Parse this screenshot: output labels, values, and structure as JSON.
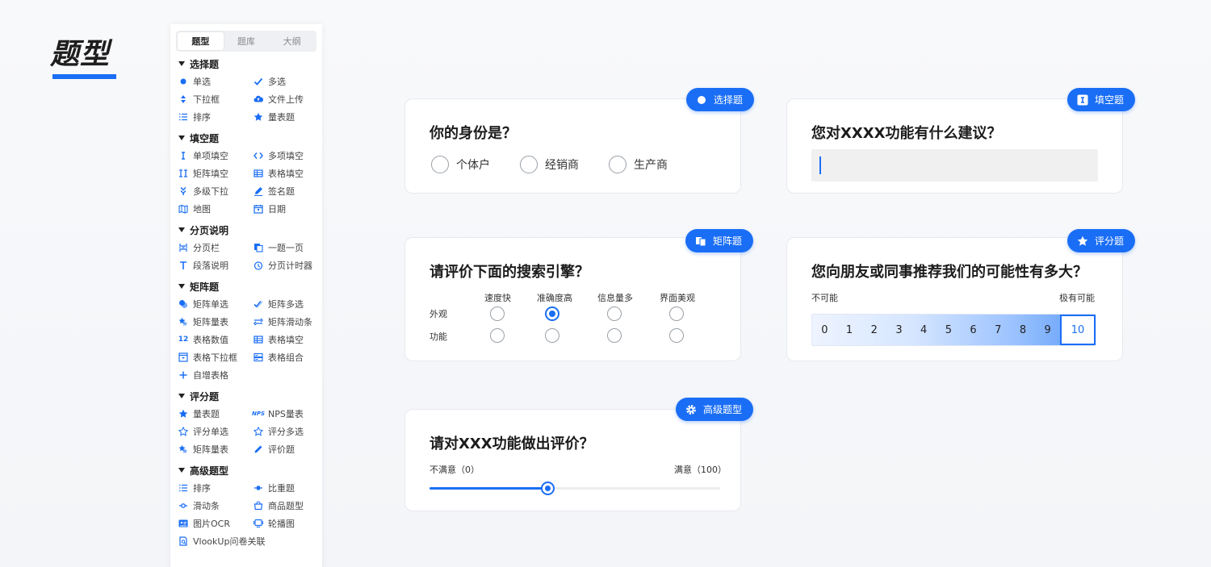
{
  "page": {
    "title": "题型"
  },
  "sidebar": {
    "tabs": [
      "题型",
      "题库",
      "大纲"
    ],
    "groups": [
      {
        "title": "选择题",
        "items": [
          {
            "label": "单选",
            "icon": "dot-icon"
          },
          {
            "label": "多选",
            "icon": "check-icon"
          },
          {
            "label": "下拉框",
            "icon": "updown-icon"
          },
          {
            "label": "文件上传",
            "icon": "cloud-upload-icon"
          },
          {
            "label": "排序",
            "icon": "list-icon"
          },
          {
            "label": "量表题",
            "icon": "star-icon"
          }
        ]
      },
      {
        "title": "填空题",
        "items": [
          {
            "label": "单项填空",
            "icon": "text-cursor-icon"
          },
          {
            "label": "多项填空",
            "icon": "code-icon"
          },
          {
            "label": "矩阵填空",
            "icon": "double-cursor-icon"
          },
          {
            "label": "表格填空",
            "icon": "table-icon"
          },
          {
            "label": "多级下拉",
            "icon": "cascade-icon"
          },
          {
            "label": "签名题",
            "icon": "pen-icon"
          },
          {
            "label": "地图",
            "icon": "map-icon"
          },
          {
            "label": "日期",
            "icon": "calendar-icon"
          }
        ]
      },
      {
        "title": "分页说明",
        "items": [
          {
            "label": "分页栏",
            "icon": "pagebreak-icon"
          },
          {
            "label": "一题一页",
            "icon": "copy-icon"
          },
          {
            "label": "段落说明",
            "icon": "text-icon"
          },
          {
            "label": "分页计时器",
            "icon": "timer-icon"
          }
        ]
      },
      {
        "title": "矩阵题",
        "items": [
          {
            "label": "矩阵单选",
            "icon": "matrix-radio-icon"
          },
          {
            "label": "矩阵多选",
            "icon": "matrix-check-icon"
          },
          {
            "label": "矩阵量表",
            "icon": "matrix-star-icon"
          },
          {
            "label": "矩阵滑动条",
            "icon": "matrix-slider-icon"
          },
          {
            "label": "表格数值",
            "icon": "number-icon"
          },
          {
            "label": "表格填空",
            "icon": "table-icon"
          },
          {
            "label": "表格下拉框",
            "icon": "dropdown-box-icon"
          },
          {
            "label": "表格组合",
            "icon": "combo-icon"
          },
          {
            "label": "自增表格",
            "icon": "plus-icon"
          }
        ]
      },
      {
        "title": "评分题",
        "items": [
          {
            "label": "量表题",
            "icon": "star-icon"
          },
          {
            "label": "NPS量表",
            "icon": "nps-icon"
          },
          {
            "label": "评分单选",
            "icon": "star-outline-icon"
          },
          {
            "label": "评分多选",
            "icon": "star-outline-icon"
          },
          {
            "label": "矩阵量表",
            "icon": "matrix-star-icon"
          },
          {
            "label": "评价题",
            "icon": "pencil-icon"
          }
        ]
      },
      {
        "title": "高级题型",
        "items": [
          {
            "label": "排序",
            "icon": "list-icon"
          },
          {
            "label": "比重题",
            "icon": "weight-icon"
          },
          {
            "label": "滑动条",
            "icon": "slider-icon"
          },
          {
            "label": "商品题型",
            "icon": "shop-icon"
          },
          {
            "label": "图片OCR",
            "icon": "ocr-icon"
          },
          {
            "label": "轮播图",
            "icon": "carousel-icon"
          },
          {
            "label": "VlookUp问卷关联",
            "icon": "link-doc-icon"
          }
        ]
      }
    ]
  },
  "cards": {
    "choice": {
      "badge": "选择题",
      "question": "你的身份是？",
      "options": [
        "个体户",
        "经销商",
        "生产商"
      ]
    },
    "fill": {
      "badge": "填空题",
      "question": "您对XXXX功能有什么建议？"
    },
    "matrix": {
      "badge": "矩阵题",
      "question": "请评价下面的搜索引擎？",
      "columns": [
        "速度快",
        "准确度高",
        "信息量多",
        "界面美观"
      ],
      "rows": [
        "外观",
        "功能"
      ],
      "selected": {
        "row": 0,
        "col": 1
      }
    },
    "nps": {
      "badge": "评分题",
      "question": "您向朋友或同事推荐我们的可能性有多大？",
      "low_label": "不可能",
      "high_label": "极有可能",
      "scale": [
        "0",
        "1",
        "2",
        "3",
        "4",
        "5",
        "6",
        "7",
        "8",
        "9",
        "10"
      ],
      "selected": "10"
    },
    "slider": {
      "badge": "高级题型",
      "question": "请对XXX功能做出评价？",
      "min_label": "不满意（0）",
      "max_label": "满意（100）",
      "value_fraction": 0.5
    }
  },
  "colors": {
    "accent": "#1a6ef5"
  }
}
